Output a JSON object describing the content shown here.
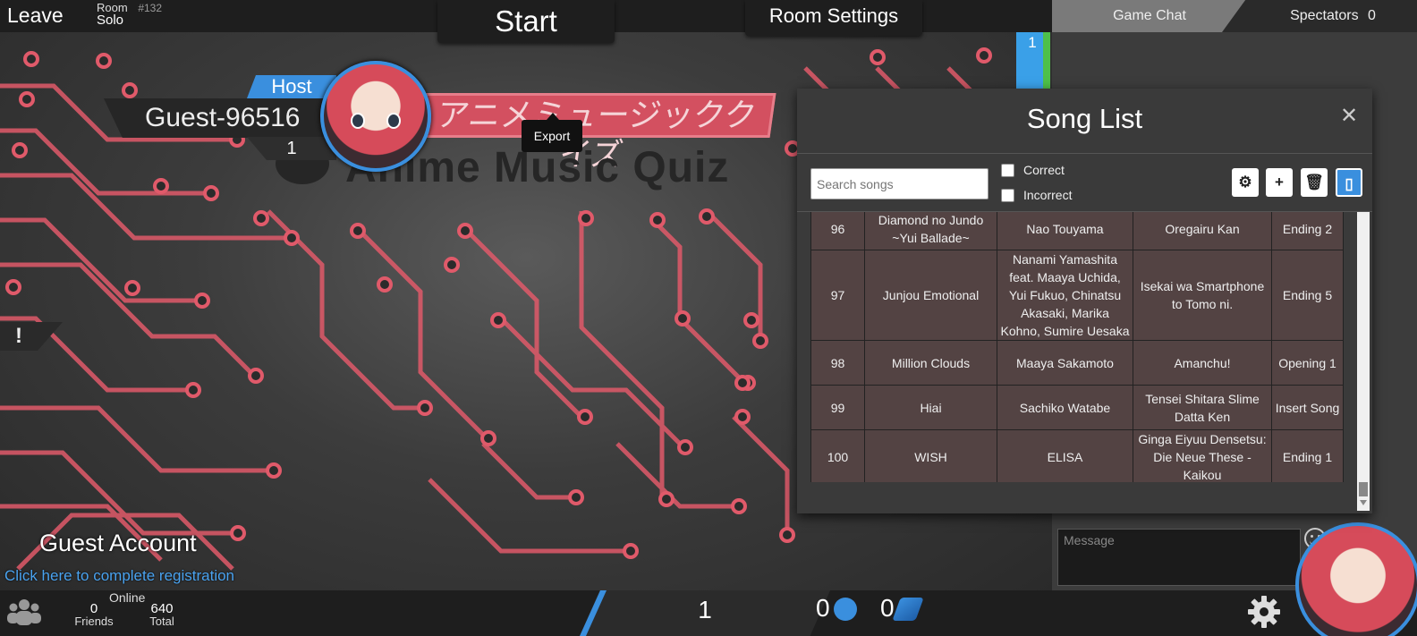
{
  "top_bar": {
    "leave_label": "Leave",
    "room_label": "Room",
    "room_number": "#132",
    "room_type": "Solo",
    "start_label": "Start",
    "room_settings_label": "Room Settings"
  },
  "side_panel": {
    "tab_chat": "Game Chat",
    "tab_spectators": "Spectators",
    "spectator_count": "0",
    "message_placeholder": "Message"
  },
  "player": {
    "host_badge": "Host",
    "name": "Guest-96516",
    "level": "1",
    "score": "1"
  },
  "logo": {
    "japanese": "アニメミュージッククイズ",
    "english": "Anime Music Quiz"
  },
  "warning_icon": "!",
  "guest": {
    "title": "Guest Account",
    "link": "Click here to complete registration"
  },
  "bottom_bar": {
    "online_label": "Online",
    "friends_count": "0",
    "friends_label": "Friends",
    "total_count": "640",
    "total_label": "Total",
    "center_count": "1",
    "note_count": "0",
    "guitar_count": "0"
  },
  "song_list": {
    "title": "Song List",
    "search_placeholder": "Search songs",
    "filter_correct": "Correct",
    "filter_incorrect": "Incorrect",
    "export_tooltip": "Export",
    "rows": [
      {
        "num": "96",
        "song": "Diamond no Jundo ~Yui Ballade~",
        "artist": "Nao Touyama",
        "anime": "Oregairu Kan",
        "type": "Ending 2"
      },
      {
        "num": "97",
        "song": "Junjou Emotional",
        "artist": "Nanami Yamashita feat. Maaya Uchida, Yui Fukuo, Chinatsu Akasaki, Marika Kohno, Sumire Uesaka",
        "anime": "Isekai wa Smartphone to Tomo ni.",
        "type": "Ending 5"
      },
      {
        "num": "98",
        "song": "Million Clouds",
        "artist": "Maaya Sakamoto",
        "anime": "Amanchu!",
        "type": "Opening 1"
      },
      {
        "num": "99",
        "song": "Hiai",
        "artist": "Sachiko Watabe",
        "anime": "Tensei Shitara Slime Datta Ken",
        "type": "Insert Song"
      },
      {
        "num": "100",
        "song": "WISH",
        "artist": "ELISA",
        "anime": "Ginga Eiyuu Densetsu: Die Neue These - Kaikou",
        "type": "Ending 1"
      }
    ]
  },
  "colors": {
    "accent_blue": "#3a8fde",
    "circuit_red": "#e05a6a",
    "table_bg": "#534343"
  }
}
